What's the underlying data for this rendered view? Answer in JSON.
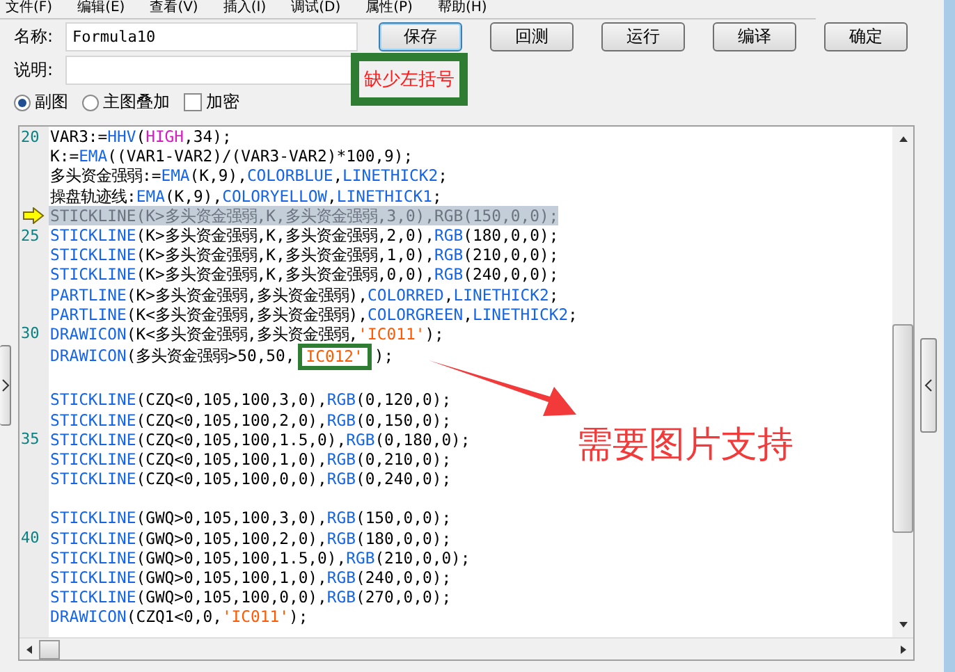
{
  "menu": [
    "文件(F)",
    "编辑(E)",
    "查看(V)",
    "插入(I)",
    "调试(D)",
    "属性(P)",
    "帮助(H)"
  ],
  "form": {
    "name_label": "名称:",
    "name_value": "Formula10",
    "desc_label": "说明:"
  },
  "buttons": [
    {
      "label": "保存",
      "focused": true
    },
    {
      "label": "回测",
      "focused": false
    },
    {
      "label": "运行",
      "focused": false
    },
    {
      "label": "编译",
      "focused": false
    },
    {
      "label": "确定",
      "focused": false
    }
  ],
  "options": [
    {
      "kind": "radio",
      "label": "副图",
      "selected": true
    },
    {
      "kind": "radio",
      "label": "主图叠加",
      "selected": false
    },
    {
      "kind": "checkbox",
      "label": "加密",
      "checked": false
    }
  ],
  "editor": {
    "lines": [
      {
        "number": "20",
        "current": false,
        "tokens": [
          {
            "kind": "plain",
            "text": "VAR3:="
          },
          {
            "kind": "func",
            "text": "HHV"
          },
          {
            "kind": "plain",
            "text": "("
          },
          {
            "kind": "var",
            "text": "HIGH"
          },
          {
            "kind": "plain",
            "text": ",34);"
          }
        ]
      },
      {
        "current": false,
        "tokens": [
          {
            "kind": "plain",
            "text": "K:="
          },
          {
            "kind": "func",
            "text": "EMA"
          },
          {
            "kind": "plain",
            "text": "((VAR1-VAR2)/(VAR3-VAR2)*100,9);"
          }
        ]
      },
      {
        "current": false,
        "tokens": [
          {
            "kind": "plain",
            "text": "多头资金强弱:="
          },
          {
            "kind": "func",
            "text": "EMA"
          },
          {
            "kind": "plain",
            "text": "(K,9),"
          },
          {
            "kind": "func",
            "text": "COLORBLUE"
          },
          {
            "kind": "plain",
            "text": ","
          },
          {
            "kind": "func",
            "text": "LINETHICK2"
          },
          {
            "kind": "plain",
            "text": ";"
          }
        ]
      },
      {
        "current": false,
        "tokens": [
          {
            "kind": "plain",
            "text": "操盘轨迹线:"
          },
          {
            "kind": "func",
            "text": "EMA"
          },
          {
            "kind": "plain",
            "text": "(K,9),"
          },
          {
            "kind": "func",
            "text": "COLORYELLOW"
          },
          {
            "kind": "plain",
            "text": ","
          },
          {
            "kind": "func",
            "text": "LINETHICK1"
          },
          {
            "kind": "plain",
            "text": ";"
          }
        ]
      },
      {
        "current": true,
        "tokens": [
          {
            "kind": "plain",
            "text": "STICKLINE(K>多头资金强弱,K,多头资金强弱,3,0),RGB(150,0,0);"
          }
        ]
      },
      {
        "number": "25",
        "current": false,
        "tokens": [
          {
            "kind": "func",
            "text": "STICKLINE"
          },
          {
            "kind": "plain",
            "text": "(K>多头资金强弱,K,多头资金强弱,2,0),"
          },
          {
            "kind": "func",
            "text": "RGB"
          },
          {
            "kind": "plain",
            "text": "(180,0,0);"
          }
        ]
      },
      {
        "current": false,
        "tokens": [
          {
            "kind": "func",
            "text": "STICKLINE"
          },
          {
            "kind": "plain",
            "text": "(K>多头资金强弱,K,多头资金强弱,1,0),"
          },
          {
            "kind": "func",
            "text": "RGB"
          },
          {
            "kind": "plain",
            "text": "(210,0,0);"
          }
        ]
      },
      {
        "current": false,
        "tokens": [
          {
            "kind": "func",
            "text": "STICKLINE"
          },
          {
            "kind": "plain",
            "text": "(K>多头资金强弱,K,多头资金强弱,0,0),"
          },
          {
            "kind": "func",
            "text": "RGB"
          },
          {
            "kind": "plain",
            "text": "(240,0,0);"
          }
        ]
      },
      {
        "current": false,
        "tokens": [
          {
            "kind": "func",
            "text": "PARTLINE"
          },
          {
            "kind": "plain",
            "text": "(K>多头资金强弱,多头资金强弱),"
          },
          {
            "kind": "func",
            "text": "COLORRED"
          },
          {
            "kind": "plain",
            "text": ","
          },
          {
            "kind": "func",
            "text": "LINETHICK2"
          },
          {
            "kind": "plain",
            "text": ";"
          }
        ]
      },
      {
        "current": false,
        "tokens": [
          {
            "kind": "func",
            "text": "PARTLINE"
          },
          {
            "kind": "plain",
            "text": "(K<多头资金强弱,多头资金强弱),"
          },
          {
            "kind": "func",
            "text": "COLORGREEN"
          },
          {
            "kind": "plain",
            "text": ","
          },
          {
            "kind": "func",
            "text": "LINETHICK2"
          },
          {
            "kind": "plain",
            "text": ";"
          }
        ]
      },
      {
        "number": "30",
        "current": false,
        "tokens": [
          {
            "kind": "func",
            "text": "DRAWICON"
          },
          {
            "kind": "plain",
            "text": "(K<多头资金强弱,多头资金强弱,"
          },
          {
            "kind": "str",
            "text": "'IC011'"
          },
          {
            "kind": "plain",
            "text": ");"
          }
        ]
      },
      {
        "current": false,
        "tokens": [
          {
            "kind": "func",
            "text": "DRAWICON"
          },
          {
            "kind": "plain",
            "text": "(多头资金强弱>50,50,"
          },
          {
            "kind": "boxed",
            "text": "IC012'"
          },
          {
            "kind": "plain",
            "text": ");"
          }
        ]
      },
      {
        "current": false
      },
      {
        "current": false,
        "tokens": [
          {
            "kind": "func",
            "text": "STICKLINE"
          },
          {
            "kind": "plain",
            "text": "(CZQ<0,105,100,3,0),"
          },
          {
            "kind": "func",
            "text": "RGB"
          },
          {
            "kind": "plain",
            "text": "(0,120,0);"
          }
        ]
      },
      {
        "current": false,
        "tokens": [
          {
            "kind": "func",
            "text": "STICKLINE"
          },
          {
            "kind": "plain",
            "text": "(CZQ<0,105,100,2,0),"
          },
          {
            "kind": "func",
            "text": "RGB"
          },
          {
            "kind": "plain",
            "text": "(0,150,0);"
          }
        ]
      },
      {
        "number": "35",
        "current": false,
        "tokens": [
          {
            "kind": "func",
            "text": "STICKLINE"
          },
          {
            "kind": "plain",
            "text": "(CZQ<0,105,100,1.5,0),"
          },
          {
            "kind": "func",
            "text": "RGB"
          },
          {
            "kind": "plain",
            "text": "(0,180,0);"
          }
        ]
      },
      {
        "current": false,
        "tokens": [
          {
            "kind": "func",
            "text": "STICKLINE"
          },
          {
            "kind": "plain",
            "text": "(CZQ<0,105,100,1,0),"
          },
          {
            "kind": "func",
            "text": "RGB"
          },
          {
            "kind": "plain",
            "text": "(0,210,0);"
          }
        ]
      },
      {
        "current": false,
        "tokens": [
          {
            "kind": "func",
            "text": "STICKLINE"
          },
          {
            "kind": "plain",
            "text": "(CZQ<0,105,100,0,0),"
          },
          {
            "kind": "func",
            "text": "RGB"
          },
          {
            "kind": "plain",
            "text": "(0,240,0);"
          }
        ]
      },
      {
        "current": false
      },
      {
        "current": false,
        "tokens": [
          {
            "kind": "func",
            "text": "STICKLINE"
          },
          {
            "kind": "plain",
            "text": "(GWQ>0,105,100,3,0),"
          },
          {
            "kind": "func",
            "text": "RGB"
          },
          {
            "kind": "plain",
            "text": "(150,0,0);"
          }
        ]
      },
      {
        "number": "40",
        "current": false,
        "tokens": [
          {
            "kind": "func",
            "text": "STICKLINE"
          },
          {
            "kind": "plain",
            "text": "(GWQ>0,105,100,2,0),"
          },
          {
            "kind": "func",
            "text": "RGB"
          },
          {
            "kind": "plain",
            "text": "(180,0,0);"
          }
        ]
      },
      {
        "current": false,
        "tokens": [
          {
            "kind": "func",
            "text": "STICKLINE"
          },
          {
            "kind": "plain",
            "text": "(GWQ>0,105,100,1.5,0),"
          },
          {
            "kind": "func",
            "text": "RGB"
          },
          {
            "kind": "plain",
            "text": "(210,0,0);"
          }
        ]
      },
      {
        "current": false,
        "tokens": [
          {
            "kind": "func",
            "text": "STICKLINE"
          },
          {
            "kind": "plain",
            "text": "(GWQ>0,105,100,1,0),"
          },
          {
            "kind": "func",
            "text": "RGB"
          },
          {
            "kind": "plain",
            "text": "(240,0,0);"
          }
        ]
      },
      {
        "current": false,
        "tokens": [
          {
            "kind": "func",
            "text": "STICKLINE"
          },
          {
            "kind": "plain",
            "text": "(GWQ>0,105,100,0,0),"
          },
          {
            "kind": "func",
            "text": "RGB"
          },
          {
            "kind": "plain",
            "text": "(270,0,0);"
          }
        ]
      },
      {
        "current": false,
        "tokens": [
          {
            "kind": "func",
            "text": "DRAWICON"
          },
          {
            "kind": "plain",
            "text": "(CZQ1<0,0,"
          },
          {
            "kind": "str",
            "text": "'IC011'"
          },
          {
            "kind": "plain",
            "text": ");"
          }
        ]
      }
    ]
  },
  "annotations": {
    "note": "缺少左括号",
    "callout": "需要图片支持"
  }
}
